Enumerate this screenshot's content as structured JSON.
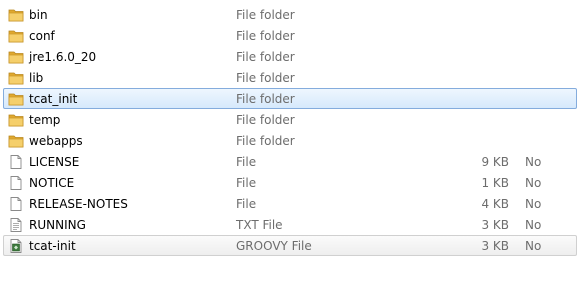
{
  "files": [
    {
      "name": "bin",
      "type": "File folder",
      "size": "",
      "attr": "",
      "icon": "folder-icon"
    },
    {
      "name": "conf",
      "type": "File folder",
      "size": "",
      "attr": "",
      "icon": "folder-icon"
    },
    {
      "name": "jre1.6.0_20",
      "type": "File folder",
      "size": "",
      "attr": "",
      "icon": "folder-icon"
    },
    {
      "name": "lib",
      "type": "File folder",
      "size": "",
      "attr": "",
      "icon": "folder-icon"
    },
    {
      "name": "tcat_init",
      "type": "File folder",
      "size": "",
      "attr": "",
      "icon": "folder-icon",
      "state": "selected"
    },
    {
      "name": "temp",
      "type": "File folder",
      "size": "",
      "attr": "",
      "icon": "folder-icon"
    },
    {
      "name": "webapps",
      "type": "File folder",
      "size": "",
      "attr": "",
      "icon": "folder-icon"
    },
    {
      "name": "LICENSE",
      "type": "File",
      "size": "9 KB",
      "attr": "No",
      "icon": "file-icon"
    },
    {
      "name": "NOTICE",
      "type": "File",
      "size": "1 KB",
      "attr": "No",
      "icon": "file-icon"
    },
    {
      "name": "RELEASE-NOTES",
      "type": "File",
      "size": "4 KB",
      "attr": "No",
      "icon": "file-icon"
    },
    {
      "name": "RUNNING",
      "type": "TXT File",
      "size": "3 KB",
      "attr": "No",
      "icon": "text-file-icon"
    },
    {
      "name": "tcat-init",
      "type": "GROOVY File",
      "size": "3 KB",
      "attr": "No",
      "icon": "groovy-file-icon",
      "state": "hovered"
    }
  ],
  "colors": {
    "folder": "#e8b84a",
    "selection": "#d6e9fc",
    "selection_border": "#84acdd",
    "secondary_text": "#6d6d6d"
  }
}
